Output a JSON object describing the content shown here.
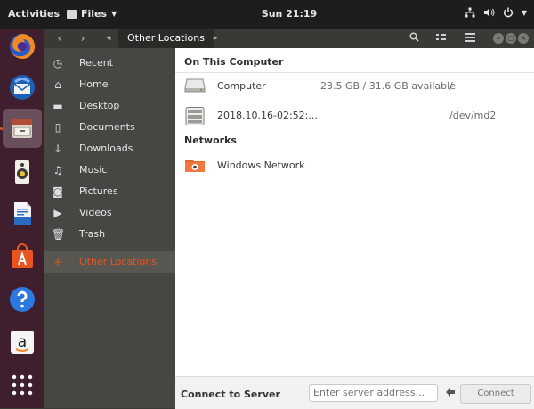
{
  "topbar": {
    "activities": "Activities",
    "app_name": "Files",
    "clock": "Sun 21:19"
  },
  "dock": {
    "apps": [
      "firefox",
      "thunderbird",
      "files",
      "rhythmbox",
      "libreoffice-writer",
      "ubuntu-software",
      "help",
      "amazon",
      "show-applications"
    ]
  },
  "headerbar": {
    "location": "Other Locations"
  },
  "sidebar": {
    "items": [
      {
        "label": "Recent",
        "icon": "clock-icon"
      },
      {
        "label": "Home",
        "icon": "home-icon"
      },
      {
        "label": "Desktop",
        "icon": "folder-icon"
      },
      {
        "label": "Documents",
        "icon": "document-icon"
      },
      {
        "label": "Downloads",
        "icon": "download-icon"
      },
      {
        "label": "Music",
        "icon": "music-icon"
      },
      {
        "label": "Pictures",
        "icon": "camera-icon"
      },
      {
        "label": "Videos",
        "icon": "video-icon"
      },
      {
        "label": "Trash",
        "icon": "trash-icon"
      },
      {
        "label": "Other Locations",
        "icon": "plus-icon"
      }
    ]
  },
  "main": {
    "section_computer": "On This Computer",
    "computer": {
      "name": "Computer",
      "info": "23.5 GB / 31.6 GB available",
      "path": "/"
    },
    "raid": {
      "name": "2018.10.16-02:52:...",
      "path": "/dev/md2"
    },
    "section_networks": "Networks",
    "network": {
      "name": "Windows Network"
    }
  },
  "footer": {
    "label": "Connect to Server",
    "placeholder": "Enter server address...",
    "connect": "Connect"
  },
  "colors": {
    "accent": "#e95420",
    "dock": "#3f1e2e",
    "topbar": "#1d1d1d"
  }
}
